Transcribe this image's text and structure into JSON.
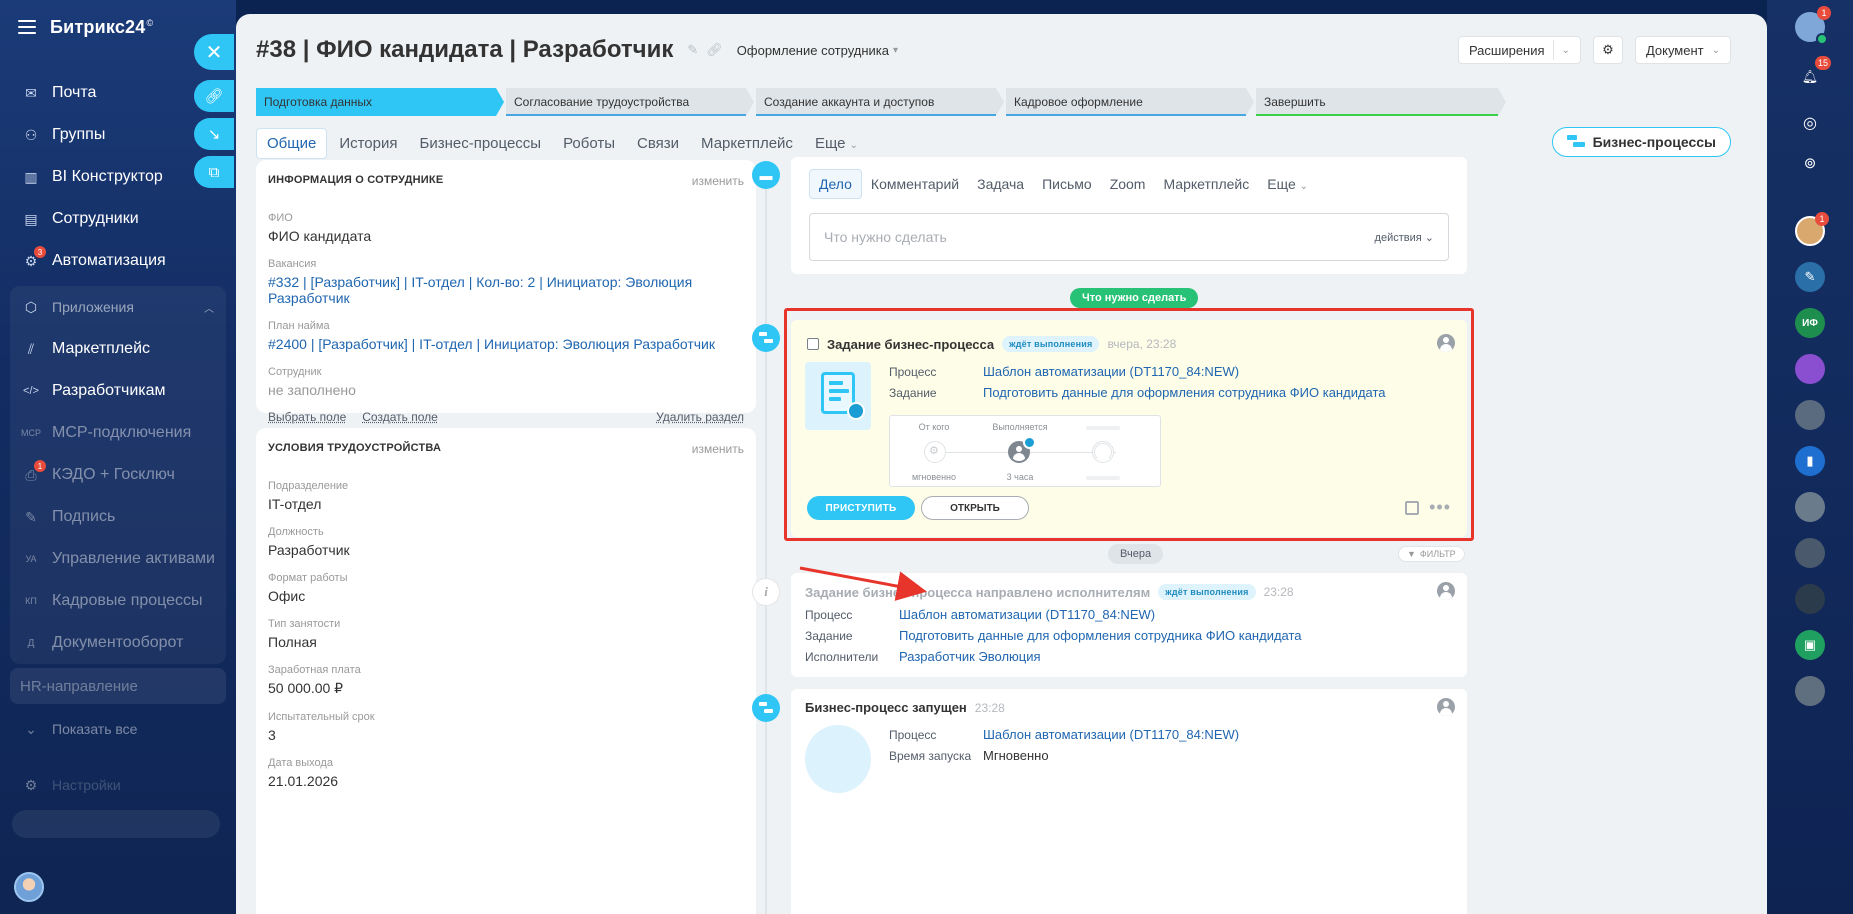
{
  "app": {
    "brand": "Битрикс24",
    "brand_mark": "©"
  },
  "sidebar": {
    "items": [
      {
        "label": "Почта",
        "icon": "mail-icon",
        "glyph": "✉"
      },
      {
        "label": "Группы",
        "icon": "groups-icon",
        "glyph": "⚇"
      },
      {
        "label": "BI Конструктор",
        "icon": "bi-chart-icon",
        "glyph": "▥"
      },
      {
        "label": "Сотрудники",
        "icon": "employees-icon",
        "glyph": "▤"
      },
      {
        "label": "Автоматизация",
        "icon": "automation-icon",
        "glyph": "⚙",
        "badge": "3"
      }
    ],
    "apps_section": {
      "label": "Приложения",
      "icon": "apps-icon",
      "glyph": "⬡"
    },
    "apps": [
      {
        "label": "Маркетплейс",
        "icon": "marketplace-icon",
        "glyph": "⫽"
      },
      {
        "label": "Разработчикам",
        "icon": "developers-icon",
        "glyph": "</>"
      },
      {
        "label": "MCP-подключения",
        "icon": "mcp-icon",
        "glyph": "MCP"
      },
      {
        "label": "КЭДО + Госключ",
        "icon": "kedo-icon",
        "glyph": "⎙",
        "badge": "1"
      },
      {
        "label": "Подпись",
        "icon": "signature-icon",
        "glyph": "✎"
      },
      {
        "label": "Управление активами",
        "icon": "assets-icon",
        "glyph": "УА"
      },
      {
        "label": "Кадровые процессы",
        "icon": "hr-processes-icon",
        "glyph": "КП"
      },
      {
        "label": "Документооборот",
        "icon": "documents-icon",
        "glyph": "Д"
      }
    ],
    "hr_item": "HR-направление",
    "show_all": "Показать все",
    "settings": "Настройки"
  },
  "header": {
    "title": "#38 | ФИО кандидата | Разработчик",
    "category": "Оформление сотрудника",
    "extensions": "Расширения",
    "document": "Документ"
  },
  "stages": [
    {
      "label": "Подготовка данных",
      "color": "#2fc6f6",
      "active": true
    },
    {
      "label": "Согласование трудоустройства",
      "color": "#47a7e0"
    },
    {
      "label": "Создание аккаунта и доступов",
      "color": "#47a7e0"
    },
    {
      "label": "Кадровое оформление",
      "color": "#47a7e0"
    },
    {
      "label": "Завершить",
      "color": "#3ad04a"
    }
  ],
  "tabs": [
    "Общие",
    "История",
    "Бизнес-процессы",
    "Роботы",
    "Связи",
    "Маркетплейс",
    "Еще"
  ],
  "bp_button": "Бизнес-процессы",
  "employee_info": {
    "title": "ИНФОРМАЦИЯ О СОТРУДНИКЕ",
    "edit": "изменить",
    "fields": [
      {
        "label": "ФИО",
        "value": "ФИО кандидата"
      },
      {
        "label": "Вакансия",
        "value": "#332 | [Разработчик] | IT-отдел | Кол-во: 2 | Инициатор: Эволюция Разработчик"
      },
      {
        "label": "План найма",
        "value": "#2400 | [Разработчик] | IT-отдел | Инициатор: Эволюция Разработчик"
      },
      {
        "label": "Сотрудник",
        "value": "не заполнено"
      }
    ],
    "select_field": "Выбрать поле",
    "create_field": "Создать поле",
    "delete_section": "Удалить раздел"
  },
  "employment": {
    "title": "УСЛОВИЯ ТРУДОУСТРОЙСТВА",
    "edit": "изменить",
    "fields": [
      {
        "label": "Подразделение",
        "value": "IT-отдел"
      },
      {
        "label": "Должность",
        "value": "Разработчик"
      },
      {
        "label": "Формат работы",
        "value": "Офис"
      },
      {
        "label": "Тип занятости",
        "value": "Полная"
      },
      {
        "label": "Заработная плата",
        "value": "50 000.00 ₽"
      },
      {
        "label": "Испытательный срок",
        "value": "3"
      },
      {
        "label": "Дата выхода",
        "value": "21.01.2026"
      }
    ]
  },
  "editor": {
    "tabs": [
      "Дело",
      "Комментарий",
      "Задача",
      "Письмо",
      "Zoom",
      "Маркетплейс",
      "Еще"
    ],
    "placeholder": "Что нужно сделать",
    "actions": "действия"
  },
  "todo_pill": "Что нужно сделать",
  "task": {
    "title": "Задание бизнес-процесса",
    "status": "ждёт выполнения",
    "time": "вчера, 23:28",
    "process_label": "Процесс",
    "process_value": "Шаблон автоматизации (DT1170_84:NEW)",
    "task_label": "Задание",
    "task_value": "Подготовить данные для оформления сотрудника ФИО кандидата",
    "flow": {
      "from": "От кого",
      "executing": "Выполняется",
      "instant": "мгновенно",
      "duration": "3 часа"
    },
    "start_button": "ПРИСТУПИТЬ",
    "open_button": "ОТКРЫТЬ"
  },
  "day_pill": "Вчера",
  "filter": "ФИЛЬТР",
  "history": [
    {
      "title": "Задание бизнес-процесса направлено исполнителям",
      "status": "ждёт выполнения",
      "time": "23:28",
      "rows": [
        {
          "label": "Процесс",
          "value": "Шаблон автоматизации (DT1170_84:NEW)"
        },
        {
          "label": "Задание",
          "value": "Подготовить данные для оформления сотрудника ФИО кандидата"
        },
        {
          "label": "Исполнители",
          "value": "Разработчик Эволюция"
        }
      ]
    },
    {
      "title": "Бизнес-процесс запущен",
      "time": "23:28",
      "rows": [
        {
          "label": "Процесс",
          "value": "Шаблон автоматизации (DT1170_84:NEW)"
        },
        {
          "label": "Время запуска",
          "value": "Мгновенно"
        }
      ]
    }
  ],
  "right_bar": {
    "badges": [
      "1",
      "15",
      "1"
    ],
    "initials": "ИФ"
  },
  "colors": {
    "accent": "#2fc6f6",
    "link": "#2066b0",
    "green": "#27c276",
    "highlight": "#e8352b",
    "sidebar": "#1b3b78"
  }
}
